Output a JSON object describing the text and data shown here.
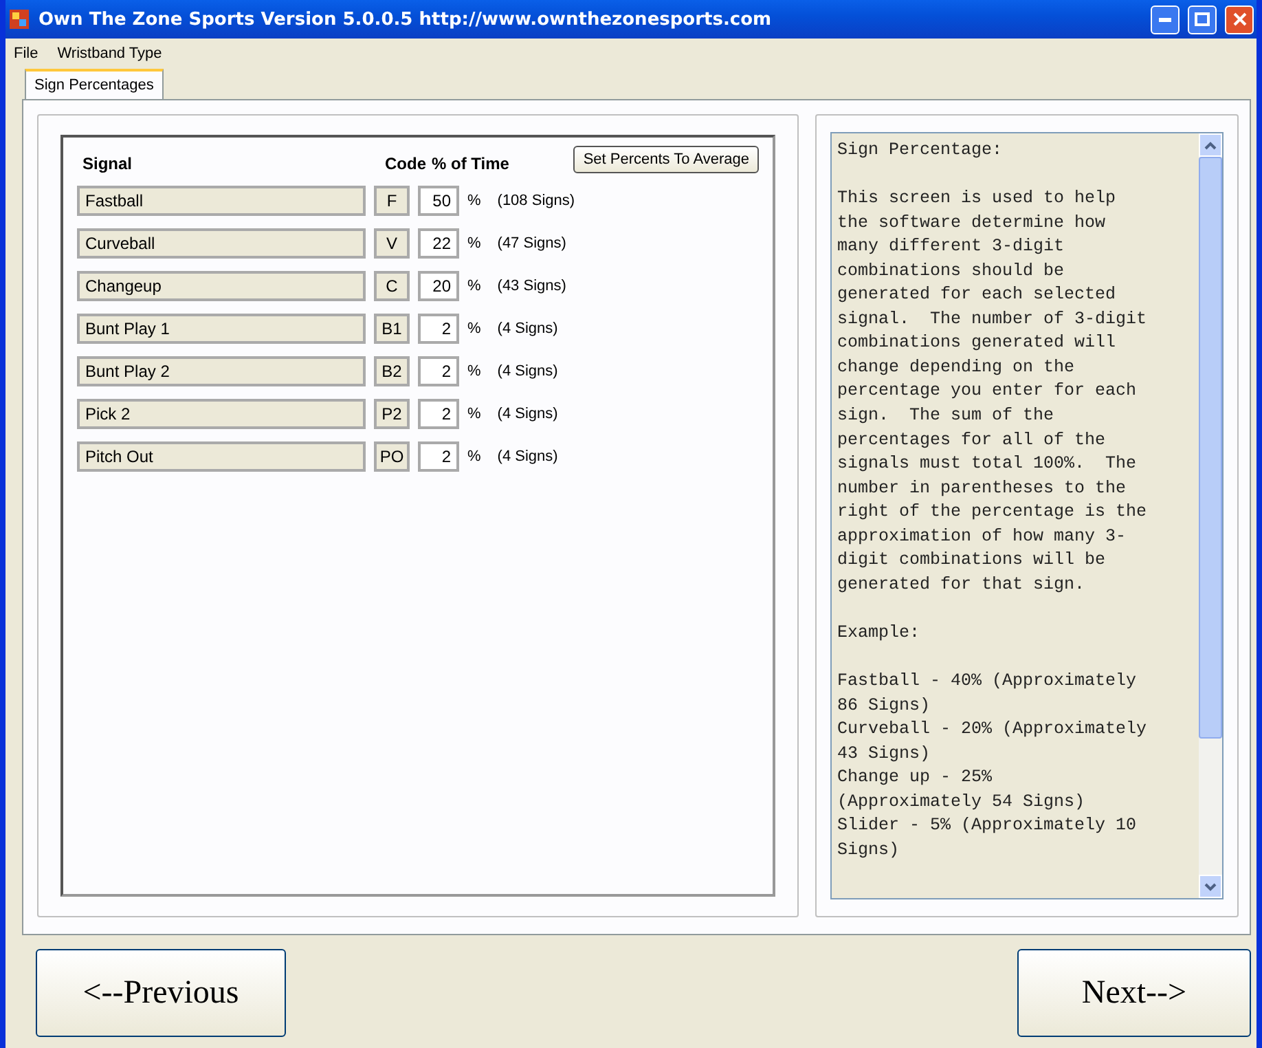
{
  "window": {
    "title": "Own The Zone Sports Version 5.0.0.5  http://www.ownthezonesports.com"
  },
  "menu": [
    "File",
    "Wristband Type"
  ],
  "tabs": [
    {
      "label": "Sign Percentages",
      "selected": true
    }
  ],
  "signals": {
    "headers": {
      "signal": "Signal",
      "code": "Code",
      "percent": "% of Time"
    },
    "average_button": "Set Percents To Average",
    "rows": [
      {
        "name": "Fastball",
        "code": "F",
        "percent": "50",
        "unit": "%",
        "signs": "(108 Signs)"
      },
      {
        "name": "Curveball",
        "code": "V",
        "percent": "22",
        "unit": "%",
        "signs": "(47 Signs)"
      },
      {
        "name": "Changeup",
        "code": "C",
        "percent": "20",
        "unit": "%",
        "signs": "(43 Signs)"
      },
      {
        "name": "Bunt Play 1",
        "code": "B1",
        "percent": "2",
        "unit": "%",
        "signs": "(4 Signs)"
      },
      {
        "name": "Bunt Play 2",
        "code": "B2",
        "percent": "2",
        "unit": "%",
        "signs": "(4 Signs)"
      },
      {
        "name": "Pick 2",
        "code": "P2",
        "percent": "2",
        "unit": "%",
        "signs": "(4 Signs)"
      },
      {
        "name": "Pitch Out",
        "code": "PO",
        "percent": "2",
        "unit": "%",
        "signs": "(4 Signs)"
      }
    ]
  },
  "help": {
    "paragraphs": [
      [
        "Sign Percentage:"
      ],
      [
        "This screen is used to help",
        "the software determine how",
        "many different 3-digit",
        "combinations should be",
        "generated for each selected",
        "signal.  The number of 3-digit",
        "combinations generated will",
        "change depending on the",
        "percentage you enter for each",
        "sign.  The sum of the",
        "percentages for all of the",
        "signals must total 100%.  The",
        "number in parentheses to the",
        "right of the percentage is the",
        "approximation of how many 3-",
        "digit combinations will be",
        "generated for that sign."
      ],
      [
        "Example:"
      ],
      [
        "Fastball - 40% (Approximately",
        "86 Signs)",
        "Curveball - 20% (Approximately",
        "43 Signs)",
        "Change up - 25%",
        "(Approximately 54 Signs)",
        "Slider - 5% (Approximately 10",
        "Signs)"
      ]
    ]
  },
  "buttons": {
    "previous": "<--Previous",
    "next": "Next-->"
  }
}
